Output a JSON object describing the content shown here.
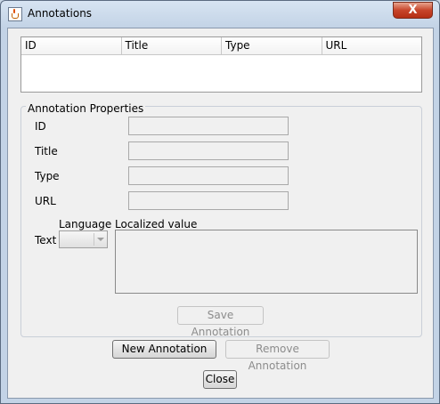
{
  "window": {
    "title": "Annotations",
    "close_glyph": "X"
  },
  "table": {
    "columns": [
      "ID",
      "Title",
      "Type",
      "URL"
    ]
  },
  "properties": {
    "legend": "Annotation  Properties",
    "id_label": "ID",
    "title_label": "Title",
    "type_label": "Type",
    "url_label": "URL",
    "language_label": "Language",
    "localized_label": "Localized value",
    "text_label": "Text",
    "save_button": "Save Annotation"
  },
  "buttons": {
    "new_annotation": "New Annotation",
    "remove_annotation": "Remove Annotation",
    "close": "Close"
  },
  "icons": {
    "app": "java-cup-icon"
  }
}
